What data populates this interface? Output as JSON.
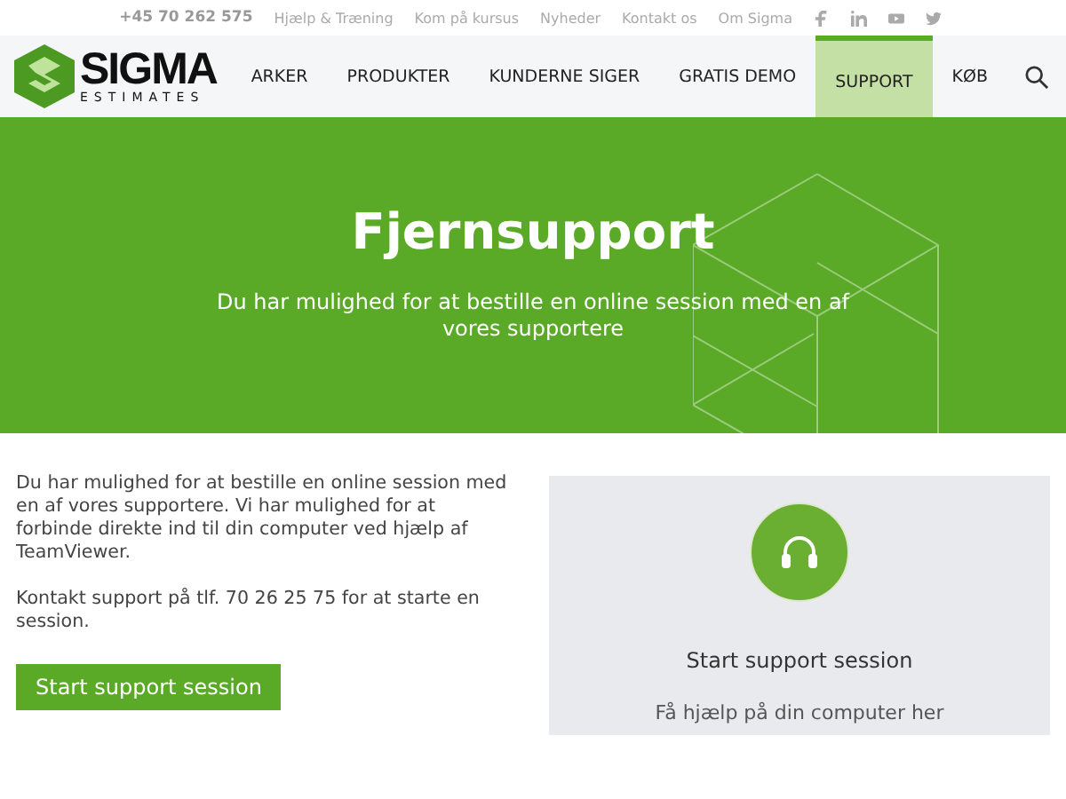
{
  "top_bar": {
    "phone": "+45 70 262 575",
    "links": [
      "Hjælp & Træning",
      "Kom på kursus",
      "Nyheder",
      "Kontakt os",
      "Om Sigma"
    ]
  },
  "logo": {
    "name": "SIGMA",
    "tagline": "ESTIMATES"
  },
  "nav": [
    {
      "label": "ARKER",
      "selected": false
    },
    {
      "label": "PRODUKTER",
      "selected": false
    },
    {
      "label": "KUNDERNE SIGER",
      "selected": false
    },
    {
      "label": "GRATIS DEMO",
      "selected": false
    },
    {
      "label": "SUPPORT",
      "selected": true
    },
    {
      "label": "KØB",
      "selected": false
    }
  ],
  "hero": {
    "title": "Fjernsupport",
    "subtitle": "Du har mulighed for at bestille en online session med en af vores supportere"
  },
  "intro": {
    "paragraphs": [
      "Du har mulighed for at bestille en online session med en af vores supportere. Vi har mulighed for at forbinde direkte ind til din computer ved hjælp af TeamViewer.",
      "Kontakt support på tlf. 70 26 25 75 for at starte en session."
    ],
    "button": "Start support session"
  },
  "card": {
    "title": "Start support session",
    "subtitle": "Få hjælp på din computer her"
  }
}
